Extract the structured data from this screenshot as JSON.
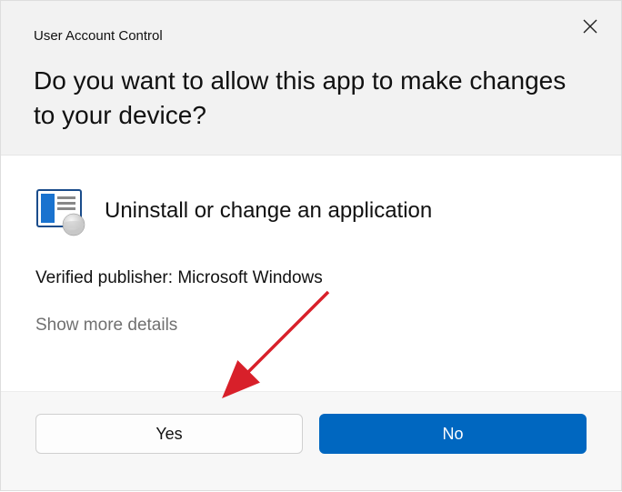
{
  "dialog": {
    "title": "User Account Control",
    "question": "Do you want to allow this app to make changes to your device?",
    "app_name": "Uninstall or change an application",
    "publisher_line": "Verified publisher: Microsoft Windows",
    "more_link": "Show more details",
    "yes_label": "Yes",
    "no_label": "No"
  },
  "annotation": {
    "arrow_points_to": "yes-button"
  }
}
